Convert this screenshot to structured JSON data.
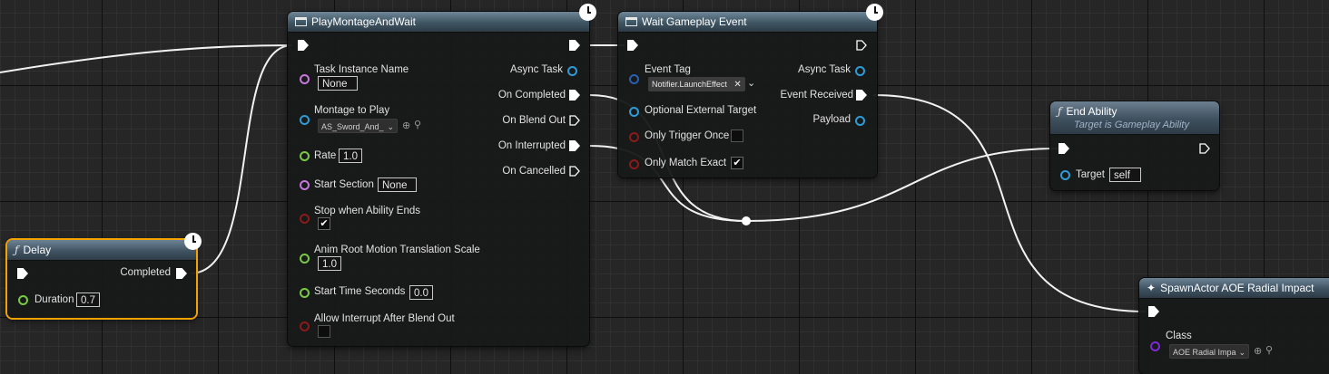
{
  "colors": {
    "exec": "#ffffff",
    "object_pin": "#2f9bd6",
    "name_pin": "#c678dd",
    "float_pin": "#7ac943",
    "bool_pin": "#8b1a1a",
    "class_pin": "#7d2ad6",
    "selection": "#f3a200"
  },
  "play_montage": {
    "title": "PlayMontageAndWait",
    "inputs": {
      "task_instance_name": {
        "label": "Task Instance Name",
        "value": "None"
      },
      "montage_to_play": {
        "label": "Montage to Play",
        "value": "AS_Sword_And_"
      },
      "rate": {
        "label": "Rate",
        "value": "1.0"
      },
      "start_section": {
        "label": "Start Section",
        "value": "None"
      },
      "stop_when_ability_ends": {
        "label": "Stop when Ability Ends",
        "checked": true
      },
      "anim_root_motion": {
        "label": "Anim Root Motion Translation Scale",
        "value": "1.0"
      },
      "start_time_seconds": {
        "label": "Start Time Seconds",
        "value": "0.0"
      },
      "allow_interrupt": {
        "label": "Allow Interrupt After Blend Out",
        "checked": false
      }
    },
    "outputs": {
      "async_task": "Async Task",
      "on_completed": "On Completed",
      "on_blend_out": "On Blend Out",
      "on_interrupted": "On Interrupted",
      "on_cancelled": "On Cancelled"
    }
  },
  "wait_event": {
    "title": "Wait Gameplay Event",
    "inputs": {
      "event_tag": {
        "label": "Event Tag",
        "value": "Notifier.LaunchEffect"
      },
      "optional_external_target": {
        "label": "Optional External Target"
      },
      "only_trigger_once": {
        "label": "Only Trigger Once",
        "checked": false
      },
      "only_match_exact": {
        "label": "Only Match Exact",
        "checked": true
      }
    },
    "outputs": {
      "async_task": "Async Task",
      "event_received": "Event Received",
      "payload": "Payload"
    }
  },
  "delay": {
    "title": "Delay",
    "duration": {
      "label": "Duration",
      "value": "0.7"
    },
    "completed": "Completed"
  },
  "end_ability": {
    "title": "End Ability",
    "subtitle": "Target is Gameplay Ability",
    "target": {
      "label": "Target",
      "value": "self"
    }
  },
  "spawn_actor": {
    "title": "SpawnActor AOE Radial Impact",
    "class": {
      "label": "Class",
      "value": "AOE Radial Impa"
    }
  }
}
